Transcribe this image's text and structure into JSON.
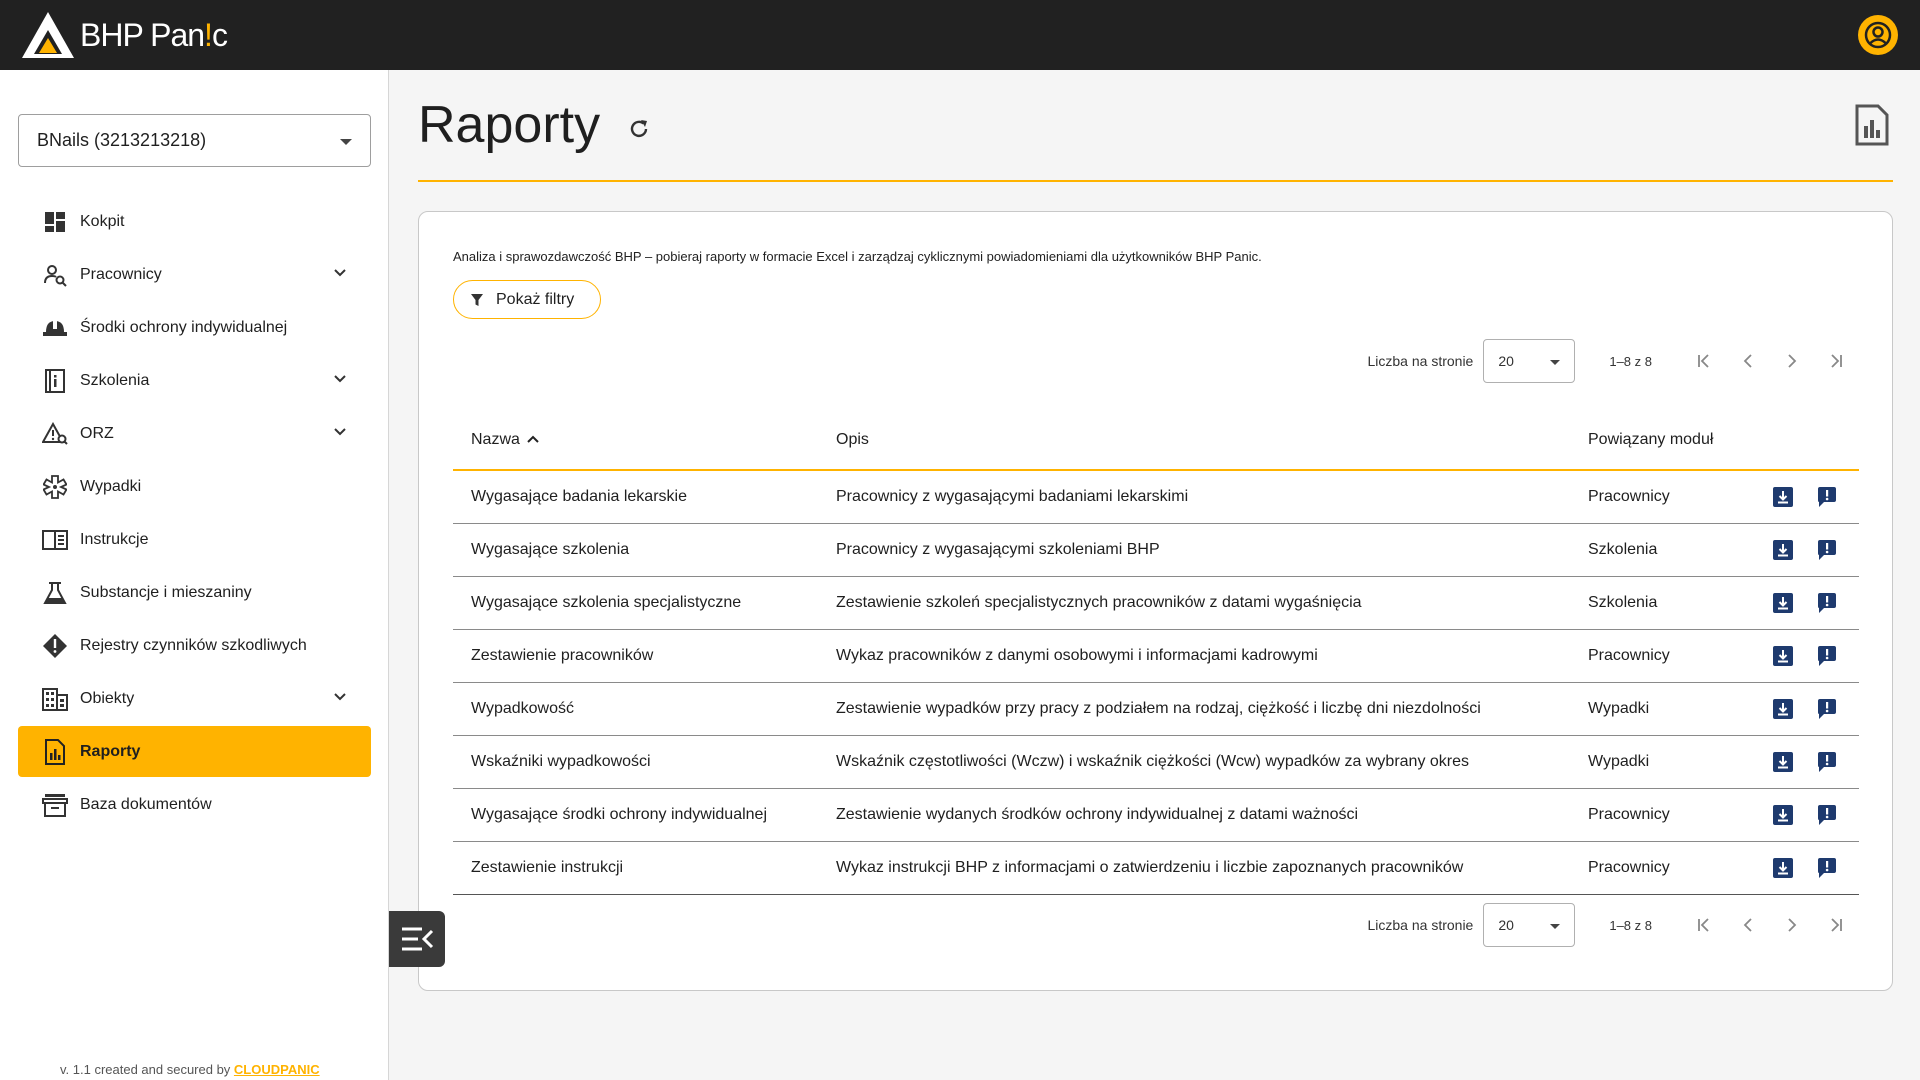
{
  "app": {
    "name_prefix": "BHP Pan",
    "name_accent": "!",
    "name_suffix": "c",
    "accent_color": "#ffb300",
    "topbar_color": "#212121"
  },
  "sidebar": {
    "company": "BNails (3213213218)",
    "items": [
      {
        "label": "Kokpit",
        "icon": "dashboard-icon",
        "expandable": false,
        "active": false
      },
      {
        "label": "Pracownicy",
        "icon": "user-search-icon",
        "expandable": true,
        "active": false
      },
      {
        "label": "Środki ochrony indywidualnej",
        "icon": "helmet-icon",
        "expandable": false,
        "active": false
      },
      {
        "label": "Szkolenia",
        "icon": "training-book-icon",
        "expandable": true,
        "active": false
      },
      {
        "label": "ORZ",
        "icon": "risk-warning-icon",
        "expandable": true,
        "active": false
      },
      {
        "label": "Wypadki",
        "icon": "medical-star-icon",
        "expandable": false,
        "active": false
      },
      {
        "label": "Instrukcje",
        "icon": "instruction-book-icon",
        "expandable": false,
        "active": false
      },
      {
        "label": "Substancje i mieszaniny",
        "icon": "flask-icon",
        "expandable": false,
        "active": false
      },
      {
        "label": "Rejestry czynników szkodliwych",
        "icon": "hazard-diamond-icon",
        "expandable": false,
        "active": false
      },
      {
        "label": "Obiekty",
        "icon": "building-icon",
        "expandable": true,
        "active": false
      },
      {
        "label": "Raporty",
        "icon": "report-chart-icon",
        "expandable": false,
        "active": true
      },
      {
        "label": "Baza dokumentów",
        "icon": "archive-box-icon",
        "expandable": false,
        "active": false
      }
    ],
    "footer_text": "v. 1.1 created and secured by ",
    "footer_brand": "CLOUDPANIC"
  },
  "main": {
    "title": "Raporty",
    "description": "Analiza i sprawozdawczość BHP – pobieraj raporty w formacie Excel i zarządzaj cyklicznymi powiadomieniami dla użytkowników BHP Panic.",
    "filter_button": "Pokaż filtry",
    "pagination": {
      "per_page_label": "Liczba na stronie",
      "per_page_value": "20",
      "range": "1–8 z 8"
    },
    "table": {
      "columns": [
        "Nazwa",
        "Opis",
        "Powiązany moduł"
      ],
      "rows": [
        {
          "name": "Wygasające badania lekarskie",
          "desc": "Pracownicy z wygasającymi badaniami lekarskimi",
          "module": "Pracownicy"
        },
        {
          "name": "Wygasające szkolenia",
          "desc": "Pracownicy z wygasającymi szkoleniami BHP",
          "module": "Szkolenia"
        },
        {
          "name": "Wygasające szkolenia specjalistyczne",
          "desc": "Zestawienie szkoleń specjalistycznych pracowników z datami wygaśnięcia",
          "module": "Szkolenia"
        },
        {
          "name": "Zestawienie pracowników",
          "desc": "Wykaz pracowników z danymi osobowymi i informacjami kadrowymi",
          "module": "Pracownicy"
        },
        {
          "name": "Wypadkowość",
          "desc": "Zestawienie wypadków przy pracy z podziałem na rodzaj, ciężkość i liczbę dni niezdolności",
          "module": "Wypadki"
        },
        {
          "name": "Wskaźniki wypadkowości",
          "desc": "Wskaźnik częstotliwości (Wczw) i wskaźnik ciężkości (Wcw) wypadków za wybrany okres",
          "module": "Wypadki"
        },
        {
          "name": "Wygasające środki ochrony indywidualnej",
          "desc": "Zestawienie wydanych środków ochrony indywidualnej z datami ważności",
          "module": "Pracownicy"
        },
        {
          "name": "Zestawienie instrukcji",
          "desc": "Wykaz instrukcji BHP z informacjami o zatwierdzeniu i liczbie zapoznanych pracowników",
          "module": "Pracownicy"
        }
      ],
      "action_icons": [
        "download-icon",
        "notification-icon"
      ],
      "action_color": "#1e3a6e"
    }
  }
}
